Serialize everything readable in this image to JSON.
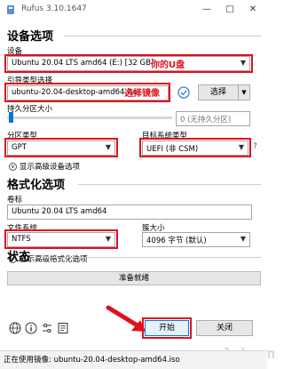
{
  "window": {
    "title": "Rufus 3.10.1647"
  },
  "drive_properties": {
    "section_title": "设备选项",
    "device": {
      "label": "设备",
      "value": "Ubuntu 20.04 LTS amd64 (E:) [32 GB]",
      "annotation": "你的U盘"
    },
    "boot_selection": {
      "label": "引导类型选择",
      "value": "ubuntu-20.04-desktop-amd64.iso",
      "annotation": "选择镜像",
      "select_button": "选择"
    },
    "persistent": {
      "label": "持久分区大小",
      "value": "0 (无持久分区)"
    },
    "partition_scheme": {
      "label": "分区类型",
      "value": "GPT"
    },
    "target_system": {
      "label": "目标系统类型",
      "value": "UEFI (非 CSM)",
      "help": "?"
    },
    "advanced_drive": "显示高级设备选项"
  },
  "format_options": {
    "section_title": "格式化选项",
    "volume_label": {
      "label": "卷标",
      "value": "Ubuntu 20.04 LTS amd64"
    },
    "file_system": {
      "label": "文件系统",
      "value": "NTFS"
    },
    "cluster_size": {
      "label": "簇大小",
      "value": "4096 字节 (默认)"
    },
    "advanced_format": "显示高级格式化选项"
  },
  "status": {
    "section_title": "状态",
    "progress_text": "准备就绪",
    "start_button": "开始",
    "close_button": "关闭"
  },
  "statusbar": {
    "text": "正在使用镜像: ubuntu-20.04-desktop-amd64.iso"
  },
  "watermark": "anquanclub.cn",
  "colors": {
    "annotation_red": "#e0101c",
    "accent_blue": "#0078d7"
  }
}
